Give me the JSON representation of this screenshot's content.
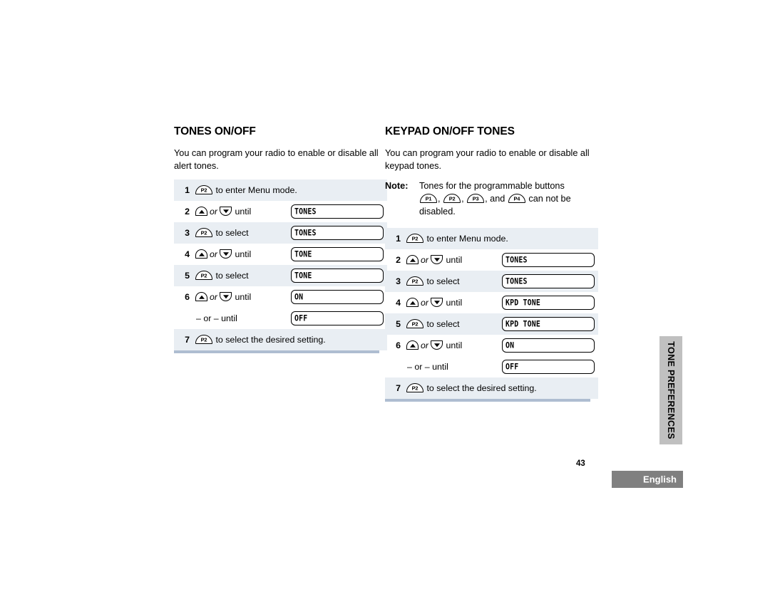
{
  "document": {
    "page_number": "43",
    "language_label": "English",
    "side_tab_label": "TONE PREFERENCES"
  },
  "sections": [
    {
      "title": "TONES ON/OFF",
      "intro": "You can program your radio to enable or disable all alert tones.",
      "note": null,
      "steps": [
        {
          "num": "1",
          "button": "P2",
          "button_type": "p",
          "action": "to enter Menu mode.",
          "lcd": null,
          "shaded": true,
          "full_width": true
        },
        {
          "num": "2",
          "button_type": "updown",
          "or_label": "or",
          "action": "until",
          "lcd": "TONES",
          "shaded": false,
          "full_width": false
        },
        {
          "num": "3",
          "button": "P2",
          "button_type": "p",
          "action": "to select",
          "lcd": "TONES",
          "shaded": true,
          "full_width": false
        },
        {
          "num": "4",
          "button_type": "updown",
          "or_label": "or",
          "action": "until",
          "lcd": "TONE",
          "shaded": false,
          "full_width": false
        },
        {
          "num": "5",
          "button": "P2",
          "button_type": "p",
          "action": "to select",
          "lcd": "TONE",
          "shaded": true,
          "full_width": false
        },
        {
          "num": "6",
          "button_type": "updown",
          "or_label": "or",
          "action": "until",
          "lcd": "ON",
          "shaded": false,
          "full_width": false
        },
        {
          "num": "",
          "button_type": "oruntil",
          "or_until_text": "– or – until",
          "lcd": "OFF",
          "shaded": false,
          "full_width": false
        },
        {
          "num": "7",
          "button": "P2",
          "button_type": "p",
          "action": "to select the desired setting.",
          "lcd": null,
          "shaded": true,
          "full_width": true
        }
      ]
    },
    {
      "title": "KEYPAD ON/OFF TONES",
      "intro": "You can program your radio to enable or disable all keypad tones.",
      "note": {
        "label": "Note:",
        "line1": "Tones for the programmable buttons",
        "buttons": [
          "P1",
          "P2",
          "P3",
          "P4"
        ],
        "line2_mid": ", and",
        "line2_end": "can not be",
        "line3": "disabled."
      },
      "steps": [
        {
          "num": "1",
          "button": "P2",
          "button_type": "p",
          "action": "to enter Menu mode.",
          "lcd": null,
          "shaded": true,
          "full_width": true
        },
        {
          "num": "2",
          "button_type": "updown",
          "or_label": "or",
          "action": "until",
          "lcd": "TONES",
          "shaded": false,
          "full_width": false
        },
        {
          "num": "3",
          "button": "P2",
          "button_type": "p",
          "action": "to select",
          "lcd": "TONES",
          "shaded": true,
          "full_width": false
        },
        {
          "num": "4",
          "button_type": "updown",
          "or_label": "or",
          "action": "until",
          "lcd": "KPD TONE",
          "shaded": false,
          "full_width": false
        },
        {
          "num": "5",
          "button": "P2",
          "button_type": "p",
          "action": "to select",
          "lcd": "KPD TONE",
          "shaded": true,
          "full_width": false
        },
        {
          "num": "6",
          "button_type": "updown",
          "or_label": "or",
          "action": "until",
          "lcd": "ON",
          "shaded": false,
          "full_width": false
        },
        {
          "num": "",
          "button_type": "oruntil",
          "or_until_text": "– or – until",
          "lcd": "OFF",
          "shaded": false,
          "full_width": false
        },
        {
          "num": "7",
          "button": "P2",
          "button_type": "p",
          "action": "to select the desired setting.",
          "lcd": null,
          "shaded": true,
          "full_width": true
        }
      ]
    }
  ],
  "colors": {
    "row_shade": "#e9eef3",
    "rule": "#aebdd1",
    "side_tab_bg": "#c0c0c0",
    "lang_box_bg": "#808080"
  }
}
